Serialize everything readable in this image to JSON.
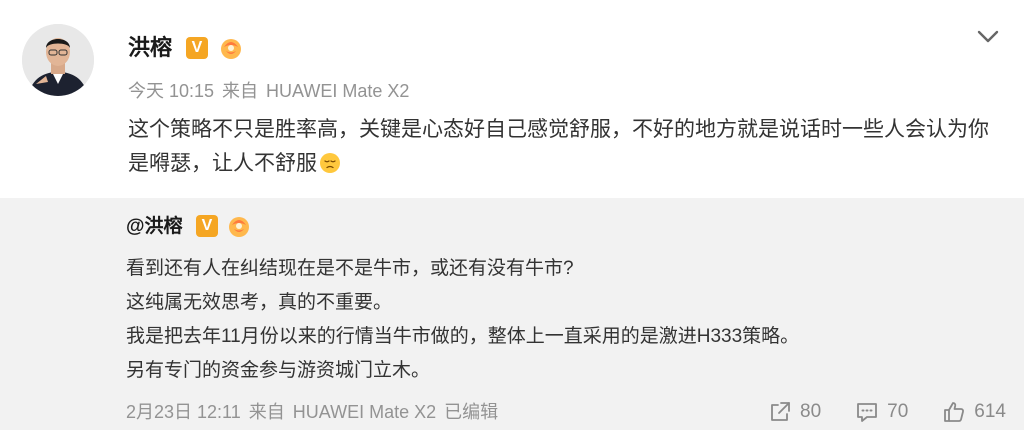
{
  "post": {
    "author": "洪榕",
    "verified_badge": "V",
    "meta": {
      "time": "今天 10:15",
      "source_prefix": "来自",
      "source": "HUAWEI Mate X2"
    },
    "text": "这个策略不只是胜率高，关键是心态好自己感觉舒服，不好的地方就是说话时一些人会认为你是嘚瑟，让人不舒服",
    "emoji": "sad-face-icon"
  },
  "retweet": {
    "author": "@洪榕",
    "verified_badge": "V",
    "lines": [
      "看到还有人在纠结现在是不是牛市，或还有没有牛市?",
      "这纯属无效思考，真的不重要。",
      "我是把去年11月份以来的行情当牛市做的，整体上一直采用的是激进H333策略。",
      "另有专门的资金参与游资城门立木。"
    ],
    "meta": {
      "time": "2月23日 12:11",
      "source_prefix": "来自",
      "source": "HUAWEI Mate X2",
      "edited": "已编辑"
    },
    "actions": {
      "share": "80",
      "comment": "70",
      "like": "614"
    }
  },
  "colors": {
    "accent_badge": "#f5a623",
    "meta_text": "#939393",
    "retweet_bg": "#f2f2f2"
  }
}
